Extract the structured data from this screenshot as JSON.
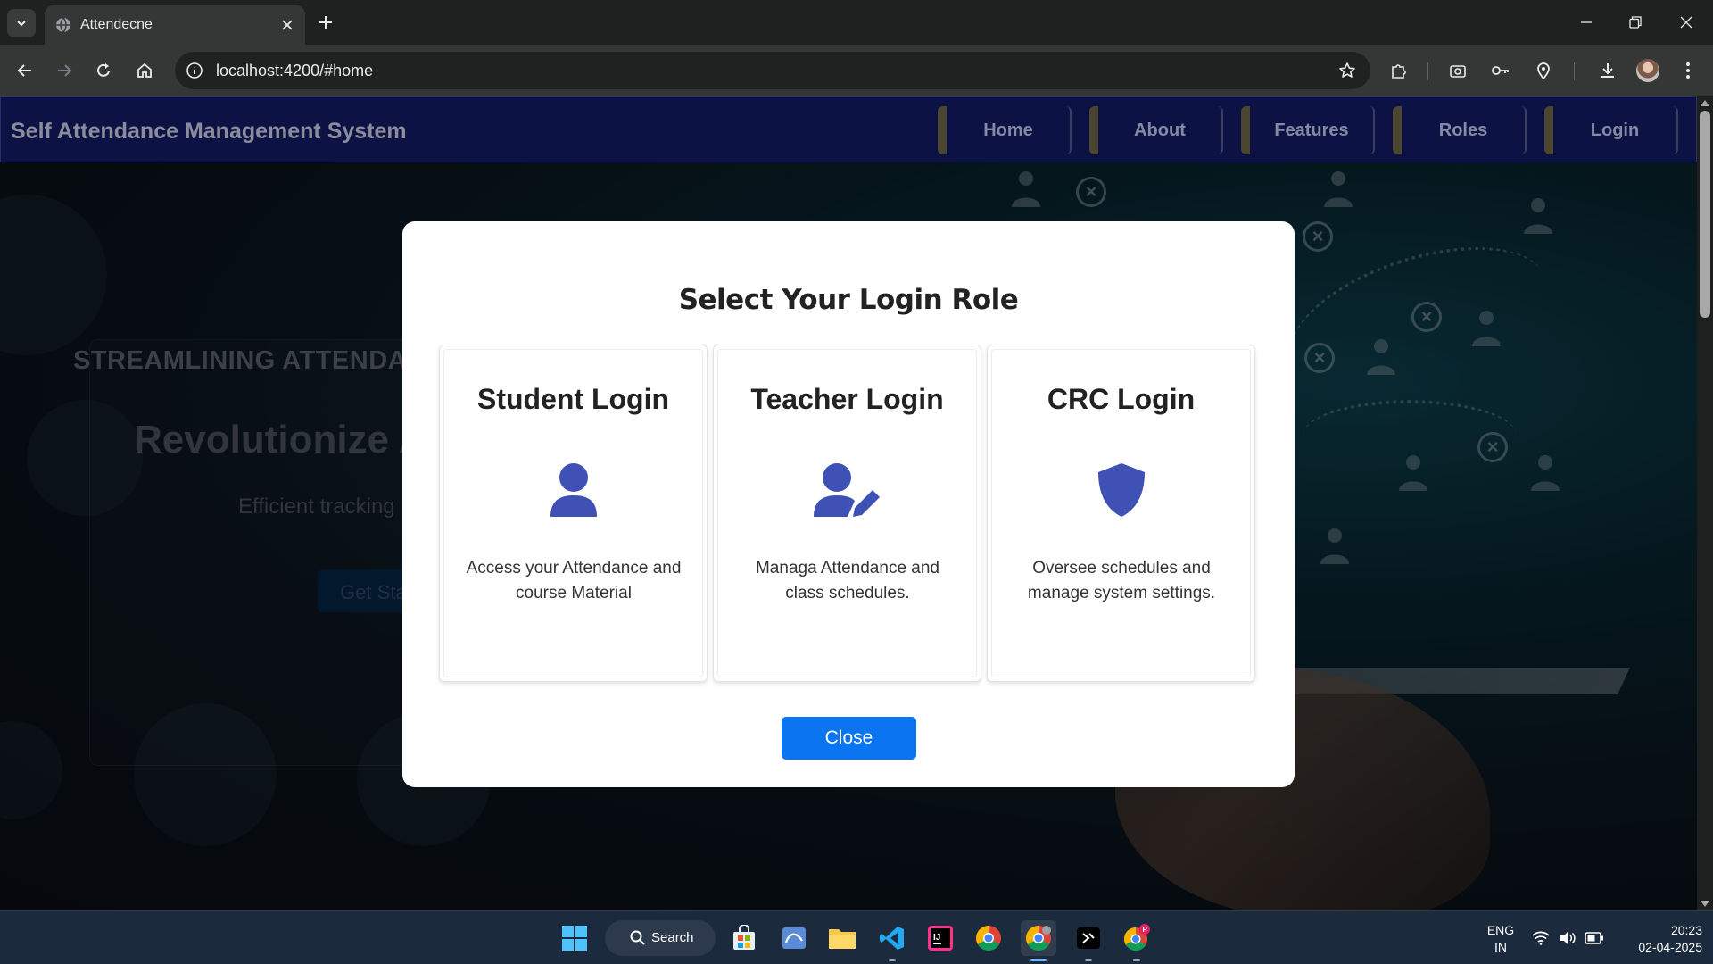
{
  "browser": {
    "tab_title": "Attendecne",
    "url": "localhost:4200/#home"
  },
  "navbar": {
    "brand": "Self Attendance Management System",
    "items": [
      {
        "label": "Home"
      },
      {
        "label": "About"
      },
      {
        "label": "Features"
      },
      {
        "label": "Roles"
      },
      {
        "label": "Login"
      }
    ]
  },
  "hero": {
    "eyebrow": "STREAMLINING ATTENDANC",
    "title": "Revolutionize At",
    "subtitle": "Efficient tracking",
    "cta": "Get Sta"
  },
  "modal": {
    "title": "Select Your Login Role",
    "roles": [
      {
        "title": "Student Login",
        "icon": "user-icon",
        "description": "Access your Attendance and course Material"
      },
      {
        "title": "Teacher Login",
        "icon": "user-pen-icon",
        "description": "Managa Attendance and class schedules."
      },
      {
        "title": "CRC Login",
        "icon": "shield-icon",
        "description": "Oversee schedules and manage system settings."
      }
    ],
    "close_label": "Close",
    "accent_color": "#3f51b5",
    "button_color": "#0b74f0"
  },
  "taskbar": {
    "search_label": "Search",
    "language": "ENG",
    "region": "IN",
    "time": "20:23",
    "date": "02-04-2025"
  }
}
